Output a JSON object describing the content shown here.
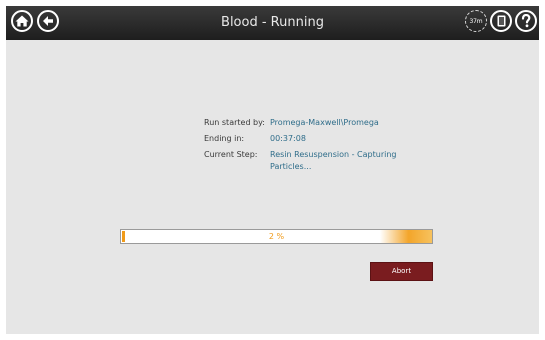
{
  "header": {
    "title": "Blood - Running",
    "timer_label": "37m",
    "icons": [
      "home-icon",
      "back-arrow-icon",
      "timer-icon",
      "door-icon",
      "help-icon"
    ]
  },
  "run_info": {
    "run_started_by_label": "Run started by:",
    "run_started_by_value": "Promega-Maxwell\\Promega",
    "ending_in_label": "Ending in:",
    "ending_in_value": "00:37:08",
    "current_step_label": "Current Step:",
    "current_step_line1": "Resin Resuspension - Capturing",
    "current_step_line2": "Particles..."
  },
  "progress": {
    "text": "2 %",
    "value_percent": 2,
    "accent_color": "#f09b1a"
  },
  "actions": {
    "abort_label": "Abort"
  },
  "colors": {
    "header_bg": "#2a2a2a",
    "screen_bg": "#e6e6e6",
    "value_text": "#2f6d8a",
    "abort_bg": "#7a1c1f"
  }
}
